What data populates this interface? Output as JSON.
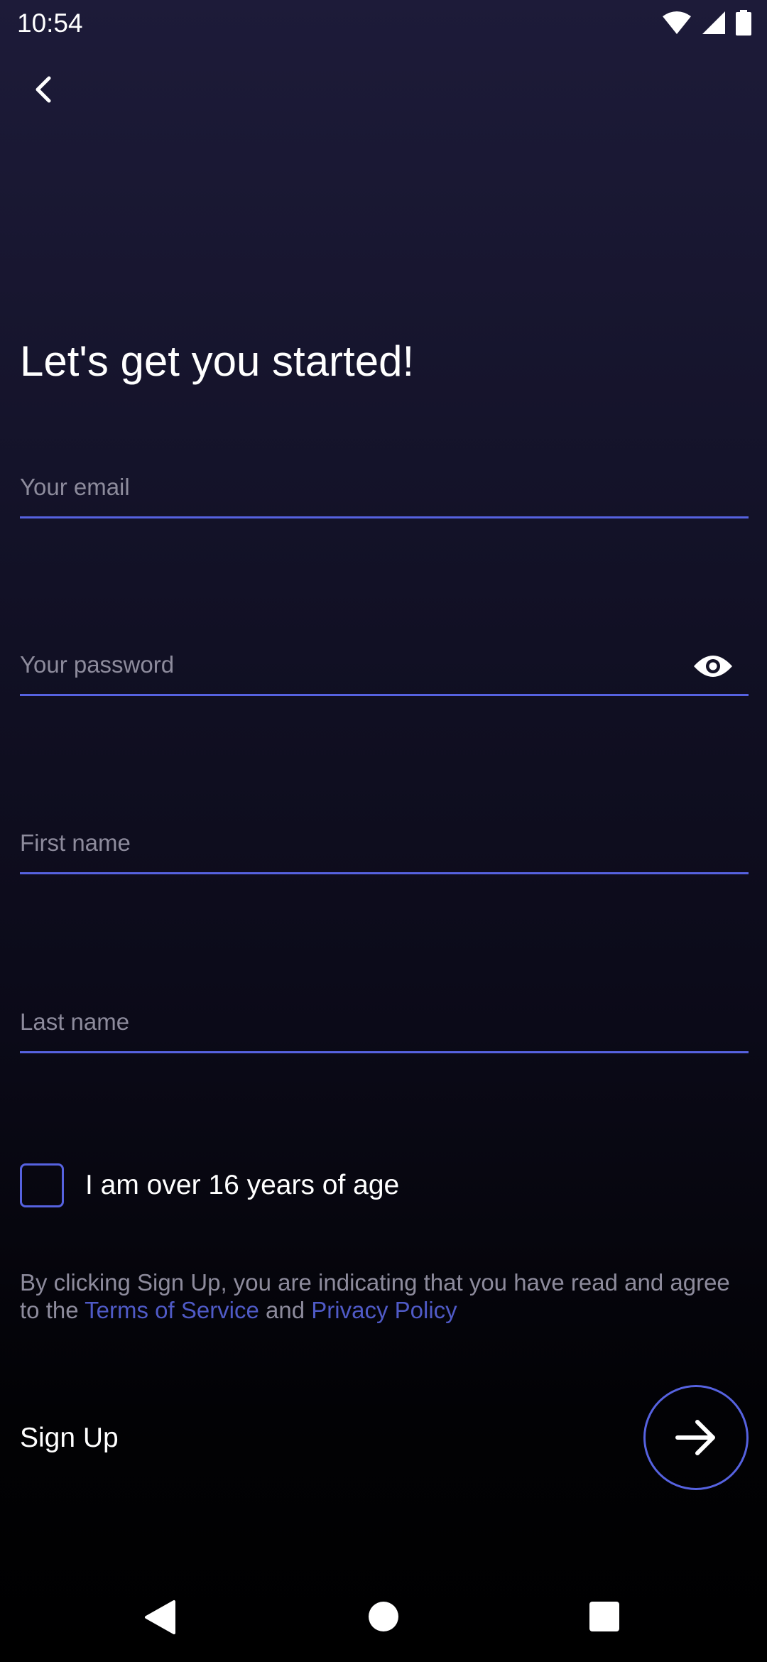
{
  "status_bar": {
    "time": "10:54",
    "icons": [
      "wifi-icon",
      "cell-signal-icon",
      "battery-icon"
    ]
  },
  "header": {
    "back_icon": "chevron-left-icon"
  },
  "title": "Let's get you started!",
  "form": {
    "email": {
      "value": "",
      "placeholder": "Your email"
    },
    "password": {
      "value": "",
      "placeholder": "Your password",
      "toggle_icon": "eye-icon"
    },
    "first_name": {
      "value": "",
      "placeholder": "First name"
    },
    "last_name": {
      "value": "",
      "placeholder": "Last name"
    },
    "age_checkbox": {
      "label": "I am over 16 years of age",
      "checked": false
    }
  },
  "legal": {
    "prefix": "By clicking Sign Up, you are indicating that you have read and agree to the ",
    "terms_link": "Terms of Service",
    "connector": " and ",
    "privacy_link": "Privacy Policy"
  },
  "signup": {
    "label": "Sign Up",
    "button_icon": "arrow-right-icon"
  },
  "nav_bar": {
    "icons": [
      "nav-back-icon",
      "nav-home-icon",
      "nav-recents-icon"
    ]
  },
  "colors": {
    "accent": "#5662e0",
    "link": "#4f5ac6",
    "placeholder": "#8d8b9c",
    "background_top": "#1d1b39",
    "background_bottom": "#000000"
  }
}
